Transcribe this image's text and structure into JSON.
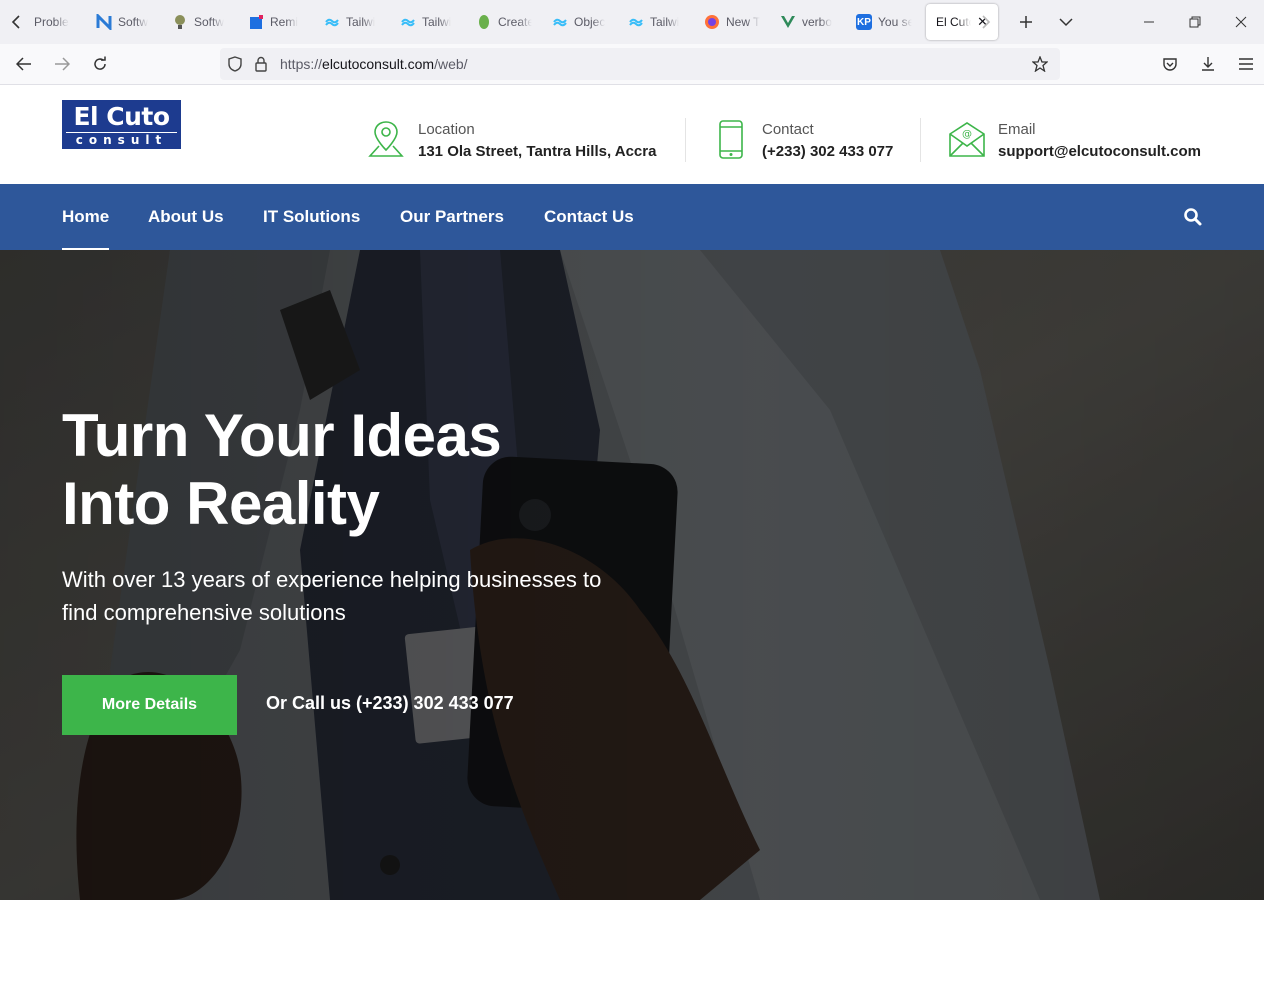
{
  "browser": {
    "tabs": [
      {
        "label": "Proble",
        "icon": "page-icon"
      },
      {
        "label": "Softw",
        "icon": "n-logo-icon"
      },
      {
        "label": "Softw",
        "icon": "bulb-icon"
      },
      {
        "label": "Remi",
        "icon": "reminder-icon"
      },
      {
        "label": "Tailwi",
        "icon": "tailwind-icon"
      },
      {
        "label": "Tailwi",
        "icon": "tailwind-icon"
      },
      {
        "label": "Create",
        "icon": "leaf-icon"
      },
      {
        "label": "Objec",
        "icon": "tailwind-icon"
      },
      {
        "label": "Tailwi",
        "icon": "tailwind-icon"
      },
      {
        "label": "New T",
        "icon": "firefox-icon"
      },
      {
        "label": "verbo",
        "icon": "vue-icon"
      },
      {
        "label": "You se",
        "icon": "kp-icon"
      }
    ],
    "active_tab": {
      "label": "El Cuto"
    },
    "url_prefix": "https://",
    "url_host": "elcutoconsult.com",
    "url_path": "/web/"
  },
  "header": {
    "logo_top": "El Cuto",
    "logo_bottom": "consult",
    "location": {
      "label": "Location",
      "value": "131 Ola Street, Tantra Hills, Accra"
    },
    "contact": {
      "label": "Contact",
      "value": "(+233) 302 433 077"
    },
    "email": {
      "label": "Email",
      "value": "support@elcutoconsult.com"
    }
  },
  "nav": {
    "items": [
      {
        "label": "Home",
        "active": true
      },
      {
        "label": "About Us"
      },
      {
        "label": "IT Solutions"
      },
      {
        "label": "Our Partners"
      },
      {
        "label": "Contact Us"
      }
    ]
  },
  "hero": {
    "title_line1": "Turn Your Ideas",
    "title_line2": "Into Reality",
    "subtitle": "With over 13 years of experience helping businesses to find comprehensive solutions",
    "button": "More Details",
    "call": "Or Call us (+233) 302 433 077"
  },
  "colors": {
    "nav_bg": "#2e579a",
    "accent_green": "#3db54a",
    "logo_blue": "#1d3b8f"
  }
}
